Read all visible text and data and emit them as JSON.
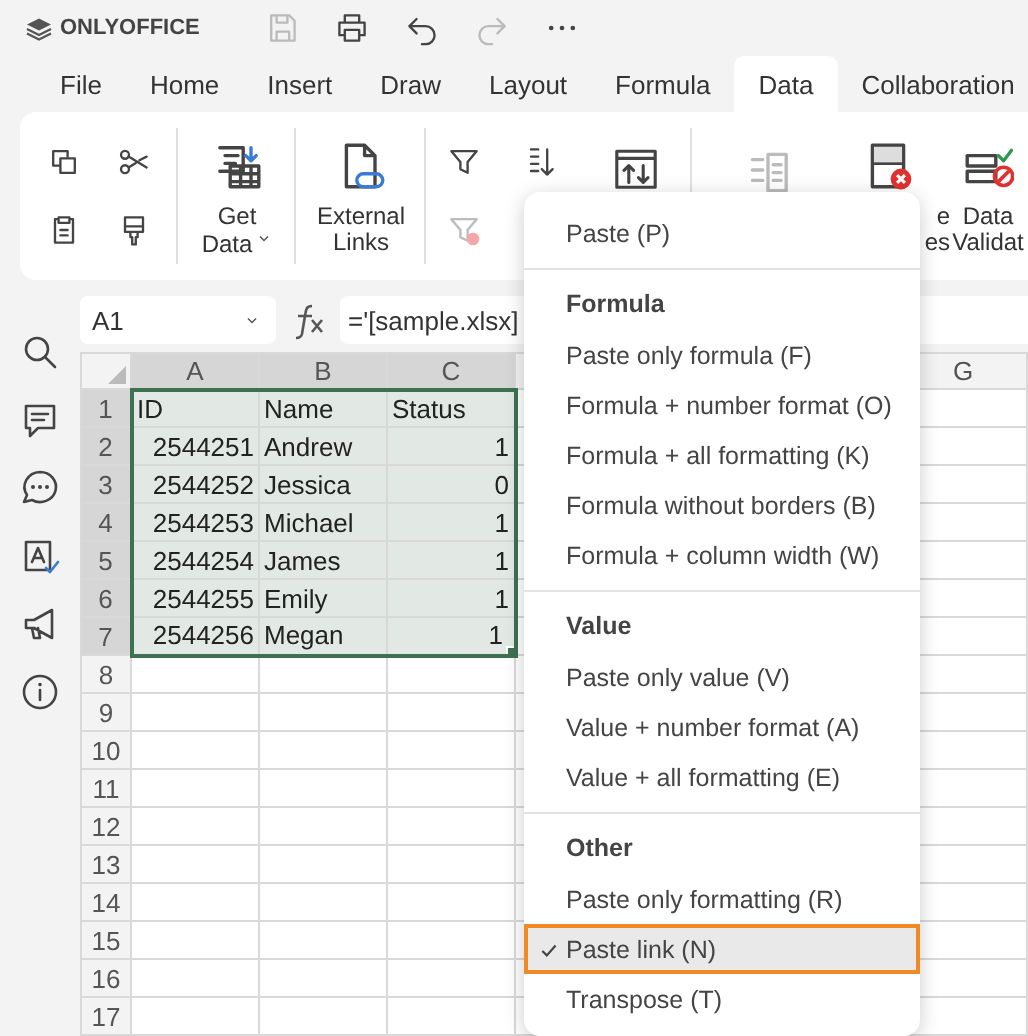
{
  "app": {
    "logo": "ONLYOFFICE"
  },
  "quick_access": [
    {
      "disabled": true
    },
    {
      "disabled": false
    },
    {
      "disabled": false
    },
    {
      "disabled": true
    },
    {
      "disabled": false
    }
  ],
  "tabs": [
    {
      "label": "File",
      "selected": false
    },
    {
      "label": "Home",
      "selected": false
    },
    {
      "label": "Insert",
      "selected": false
    },
    {
      "label": "Draw",
      "selected": false
    },
    {
      "label": "Layout",
      "selected": false
    },
    {
      "label": "Formula",
      "selected": false
    },
    {
      "label": "Data",
      "selected": true
    },
    {
      "label": "Collaboration",
      "selected": false
    }
  ],
  "ribbon": {
    "groups": [
      {
        "buttons": [
          {
            "kind": "small",
            "disabled": false
          },
          {
            "kind": "small",
            "disabled": false
          },
          {
            "kind": "small",
            "disabled": false
          },
          {
            "kind": "small",
            "disabled": false
          }
        ]
      },
      {
        "buttons": [
          {
            "kind": "large",
            "label": [
              "Get",
              "Data"
            ],
            "dropdown": true,
            "disabled": false
          }
        ]
      },
      {
        "buttons": [
          {
            "kind": "large",
            "label": [
              "External",
              "Links"
            ],
            "dropdown": false,
            "disabled": false
          }
        ]
      },
      {
        "buttons": [
          {
            "kind": "small",
            "disabled": false
          },
          {
            "kind": "small",
            "disabled": true
          },
          {
            "kind": "small",
            "disabled": false
          },
          {
            "kind": "large",
            "disabled": false
          }
        ]
      },
      {
        "buttons": [
          {
            "kind": "large",
            "disabled": true
          },
          {
            "kind": "large",
            "label": [
              "e",
              "es"
            ],
            "dropdown": false,
            "disabled": false
          },
          {
            "kind": "large",
            "label": [
              "Data",
              "Validat"
            ],
            "dropdown": false,
            "disabled": false
          }
        ]
      }
    ]
  },
  "formula_bar": {
    "name_box": "A1",
    "formula": "='[sample.xlsx]"
  },
  "grid": {
    "columns": [
      {
        "label": "A",
        "selected": true
      },
      {
        "label": "B",
        "selected": true
      },
      {
        "label": "C",
        "selected": true
      },
      {
        "label": "G",
        "selected": false
      }
    ],
    "rows": [
      {
        "header": "1",
        "selected": true,
        "cells": [
          {
            "text": "ID",
            "kind": "text",
            "selected": true
          },
          {
            "text": "Name",
            "kind": "text",
            "selected": true
          },
          {
            "text": "Status",
            "kind": "text",
            "selected": true
          }
        ]
      },
      {
        "header": "2",
        "selected": true,
        "cells": [
          {
            "text": "2544251",
            "kind": "number",
            "selected": true
          },
          {
            "text": "Andrew",
            "kind": "text",
            "selected": true
          },
          {
            "text": "1",
            "kind": "number",
            "selected": true
          }
        ]
      },
      {
        "header": "3",
        "selected": true,
        "cells": [
          {
            "text": "2544252",
            "kind": "number",
            "selected": true
          },
          {
            "text": "Jessica",
            "kind": "text",
            "selected": true
          },
          {
            "text": "0",
            "kind": "number",
            "selected": true
          }
        ]
      },
      {
        "header": "4",
        "selected": true,
        "cells": [
          {
            "text": "2544253",
            "kind": "number",
            "selected": true
          },
          {
            "text": "Michael",
            "kind": "text",
            "selected": true
          },
          {
            "text": "1",
            "kind": "number",
            "selected": true
          }
        ]
      },
      {
        "header": "5",
        "selected": true,
        "cells": [
          {
            "text": "2544254",
            "kind": "number",
            "selected": true
          },
          {
            "text": "James",
            "kind": "text",
            "selected": true
          },
          {
            "text": "1",
            "kind": "number",
            "selected": true
          }
        ]
      },
      {
        "header": "6",
        "selected": true,
        "cells": [
          {
            "text": "2544255",
            "kind": "number",
            "selected": true
          },
          {
            "text": "Emily",
            "kind": "text",
            "selected": true
          },
          {
            "text": "1",
            "kind": "number",
            "selected": true
          }
        ]
      },
      {
        "header": "7",
        "selected": true,
        "cells": [
          {
            "text": "2544256",
            "kind": "number",
            "selected": true
          },
          {
            "text": "Megan",
            "kind": "text",
            "selected": true
          },
          {
            "text": "1",
            "kind": "number",
            "selected": true
          }
        ]
      },
      {
        "header": "8",
        "selected": false,
        "cells": []
      },
      {
        "header": "9",
        "selected": false,
        "cells": []
      },
      {
        "header": "10",
        "selected": false,
        "cells": []
      },
      {
        "header": "11",
        "selected": false,
        "cells": []
      },
      {
        "header": "12",
        "selected": false,
        "cells": []
      },
      {
        "header": "13",
        "selected": false,
        "cells": []
      },
      {
        "header": "14",
        "selected": false,
        "cells": []
      },
      {
        "header": "15",
        "selected": false,
        "cells": []
      },
      {
        "header": "16",
        "selected": false,
        "cells": []
      },
      {
        "header": "17",
        "selected": false,
        "cells": []
      }
    ]
  },
  "context_menu": {
    "items": [
      {
        "kind": "item",
        "label": "Paste (P)",
        "checked": false,
        "highlighted": false
      },
      {
        "kind": "divider"
      },
      {
        "kind": "heading",
        "label": "Formula"
      },
      {
        "kind": "item",
        "label": "Paste only formula (F)",
        "checked": false,
        "highlighted": false
      },
      {
        "kind": "item",
        "label": "Formula + number format (O)",
        "checked": false,
        "highlighted": false
      },
      {
        "kind": "item",
        "label": "Formula + all formatting (K)",
        "checked": false,
        "highlighted": false
      },
      {
        "kind": "item",
        "label": "Formula without borders (B)",
        "checked": false,
        "highlighted": false
      },
      {
        "kind": "item",
        "label": "Formula + column width (W)",
        "checked": false,
        "highlighted": false
      },
      {
        "kind": "divider"
      },
      {
        "kind": "heading",
        "label": "Value"
      },
      {
        "kind": "item",
        "label": "Paste only value (V)",
        "checked": false,
        "highlighted": false
      },
      {
        "kind": "item",
        "label": "Value + number format (A)",
        "checked": false,
        "highlighted": false
      },
      {
        "kind": "item",
        "label": "Value + all formatting (E)",
        "checked": false,
        "highlighted": false
      },
      {
        "kind": "divider"
      },
      {
        "kind": "heading",
        "label": "Other"
      },
      {
        "kind": "item",
        "label": "Paste only formatting (R)",
        "checked": false,
        "highlighted": false
      },
      {
        "kind": "item",
        "label": "Paste link (N)",
        "checked": true,
        "highlighted": true
      },
      {
        "kind": "item",
        "label": "Transpose (T)",
        "checked": false,
        "highlighted": false
      }
    ]
  }
}
